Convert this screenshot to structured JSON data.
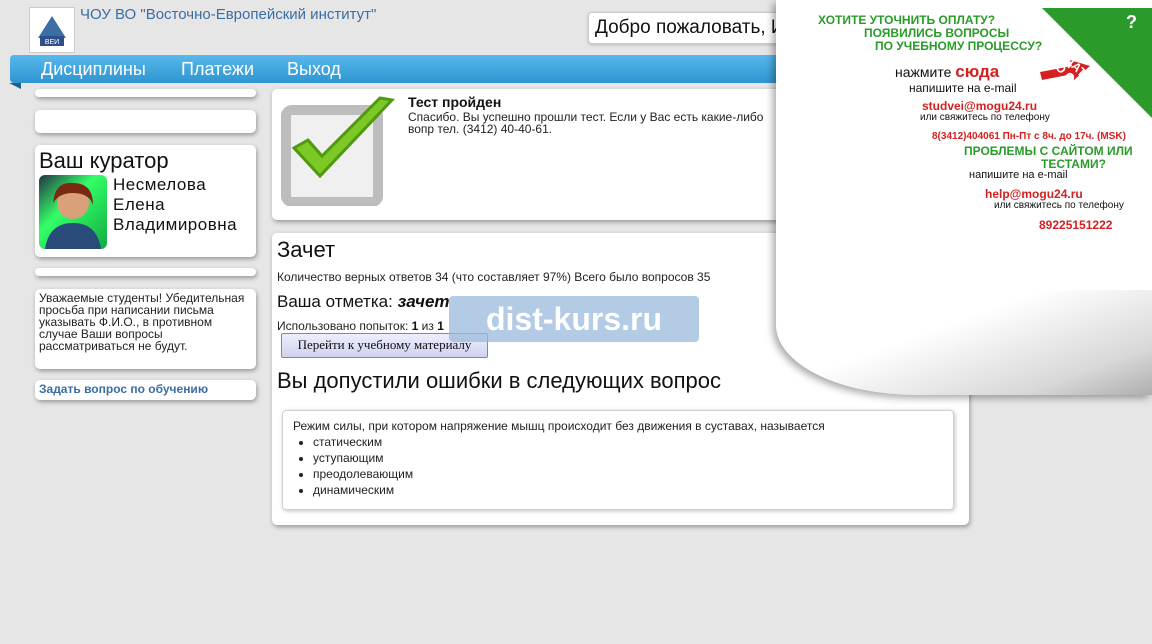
{
  "header": {
    "org_name": "ЧОУ ВО \"Восточно-Европейский институт\"",
    "logo_text": "ВЕИ",
    "welcome": "Добро пожаловать, И"
  },
  "nav": {
    "items": [
      "Дисциплины",
      "Платежи",
      "Выход"
    ]
  },
  "sidebar": {
    "curator_title": "Ваш куратор",
    "curator_name_1": "Несмелова",
    "curator_name_2": "Елена",
    "curator_name_3": "Владимировна",
    "notice": "Уважаемые студенты! Убедительная просьба при написании письма указывать Ф.И.О., в противном случае Ваши вопросы рассматриваться не будут.",
    "ask_link": "Задать вопрос по обучению"
  },
  "test": {
    "title": "Тест пройден",
    "text": "Спасибо. Вы успешно прошли тест. Если у Вас есть какие-либо вопр тел. (3412) 40-40-61."
  },
  "result": {
    "title": "Зачет",
    "stats": "Количество верных ответов 34 (что составляет 97%) Всего было вопросов 35",
    "mark_label": "Ваша отметка:",
    "mark_value": "зачет",
    "attempts_label": "Использовано попыток:",
    "attempts_used": "1",
    "attempts_sep": "из",
    "attempts_total": "1",
    "goto_button": "Перейти к учебному материалу",
    "watermark": "dist-kurs.ru",
    "errors_title": "Вы допустили ошибки в следующих вопрос",
    "question": "Режим силы, при котором напряжение мышц происходит без движения в суставах, называется",
    "options": [
      "статическим",
      "уступающим",
      "преодолевающим",
      "динамическим"
    ]
  },
  "promo": {
    "line1": "ХОТИТЕ УТОЧНИТЬ ОПЛАТУ?",
    "line2": "ПОЯВИЛИСЬ ВОПРОСЫ",
    "line3": "ПО УЧЕБНОМУ ПРОЦЕССУ?",
    "press": "нажмите",
    "here": "сюда",
    "write_email": "напишите на e-mail",
    "email1": "studvei@mogu24.ru",
    "or_call": "или свяжитесь по телефону",
    "phone1": "8(3412)404061 Пн-Пт с 8ч. до 17ч. (MSK)",
    "problems1": "ПРОБЛЕМЫ С САЙТОМ ИЛИ",
    "problems2": "ТЕСТАМИ?",
    "write_email2": "напишите на e-mail",
    "email2": "help@mogu24.ru",
    "or_call2": "или свяжитесь по телефону",
    "phone2": "89225151222",
    "corner_q": "?",
    "corner_text": "ЗАДАТЬ ВОПРОС ПО ОБУЧЕНИЮ",
    "green": "#2a9a2a",
    "red": "#d42020"
  },
  "colors": {
    "nav": "#3ba4dd",
    "link": "#3a6ea5"
  }
}
